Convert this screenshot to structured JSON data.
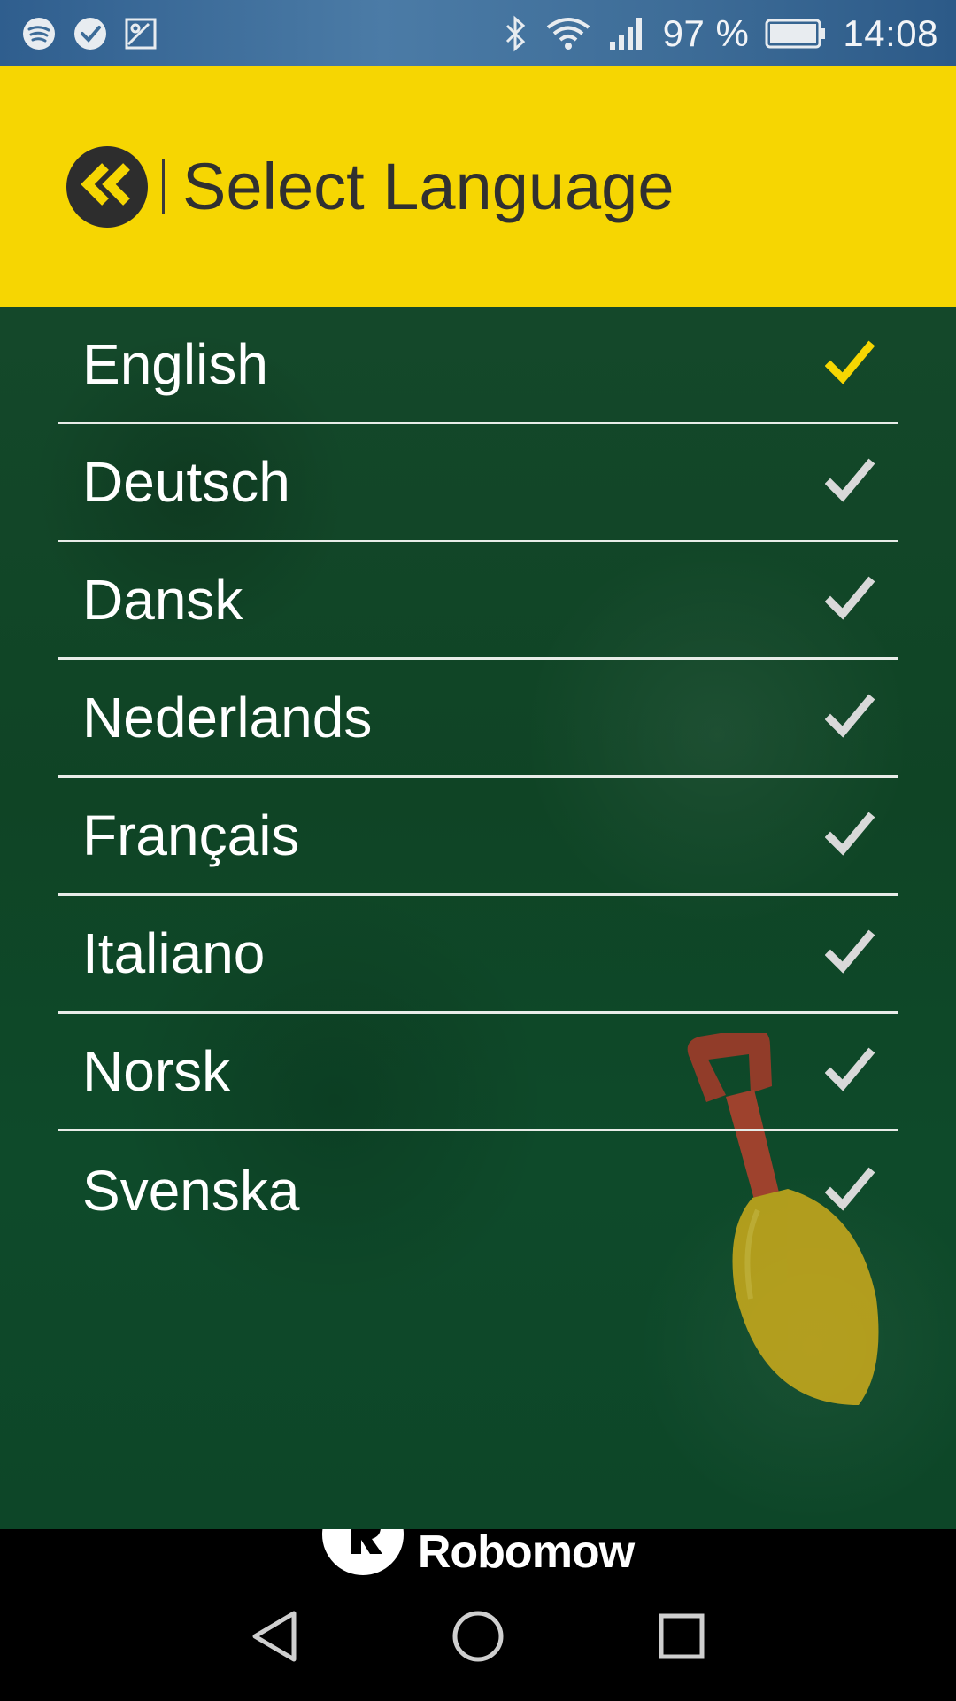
{
  "status_bar": {
    "battery_text": "97 %",
    "time": "14:08",
    "left_icons": [
      "spotify-icon",
      "check-circle-icon",
      "image-icon"
    ],
    "right_icons": [
      "bluetooth-icon",
      "wifi-icon",
      "signal-icon",
      "battery-icon"
    ]
  },
  "header": {
    "title": "Select Language",
    "accent_color": "#f6d602"
  },
  "languages": {
    "items": [
      {
        "label": "English",
        "selected": true
      },
      {
        "label": "Deutsch",
        "selected": false
      },
      {
        "label": "Dansk",
        "selected": false
      },
      {
        "label": "Nederlands",
        "selected": false
      },
      {
        "label": "Français",
        "selected": false
      },
      {
        "label": "Italiano",
        "selected": false
      },
      {
        "label": "Norsk",
        "selected": false
      },
      {
        "label": "Svenska",
        "selected": false
      }
    ],
    "selected_check_color": "#f6d602",
    "unselected_check_color": "#d9d9d9"
  },
  "brand": {
    "name": "Robomow"
  },
  "nav": {
    "icons": [
      "back-triangle-icon",
      "home-circle-icon",
      "recents-square-icon"
    ]
  }
}
